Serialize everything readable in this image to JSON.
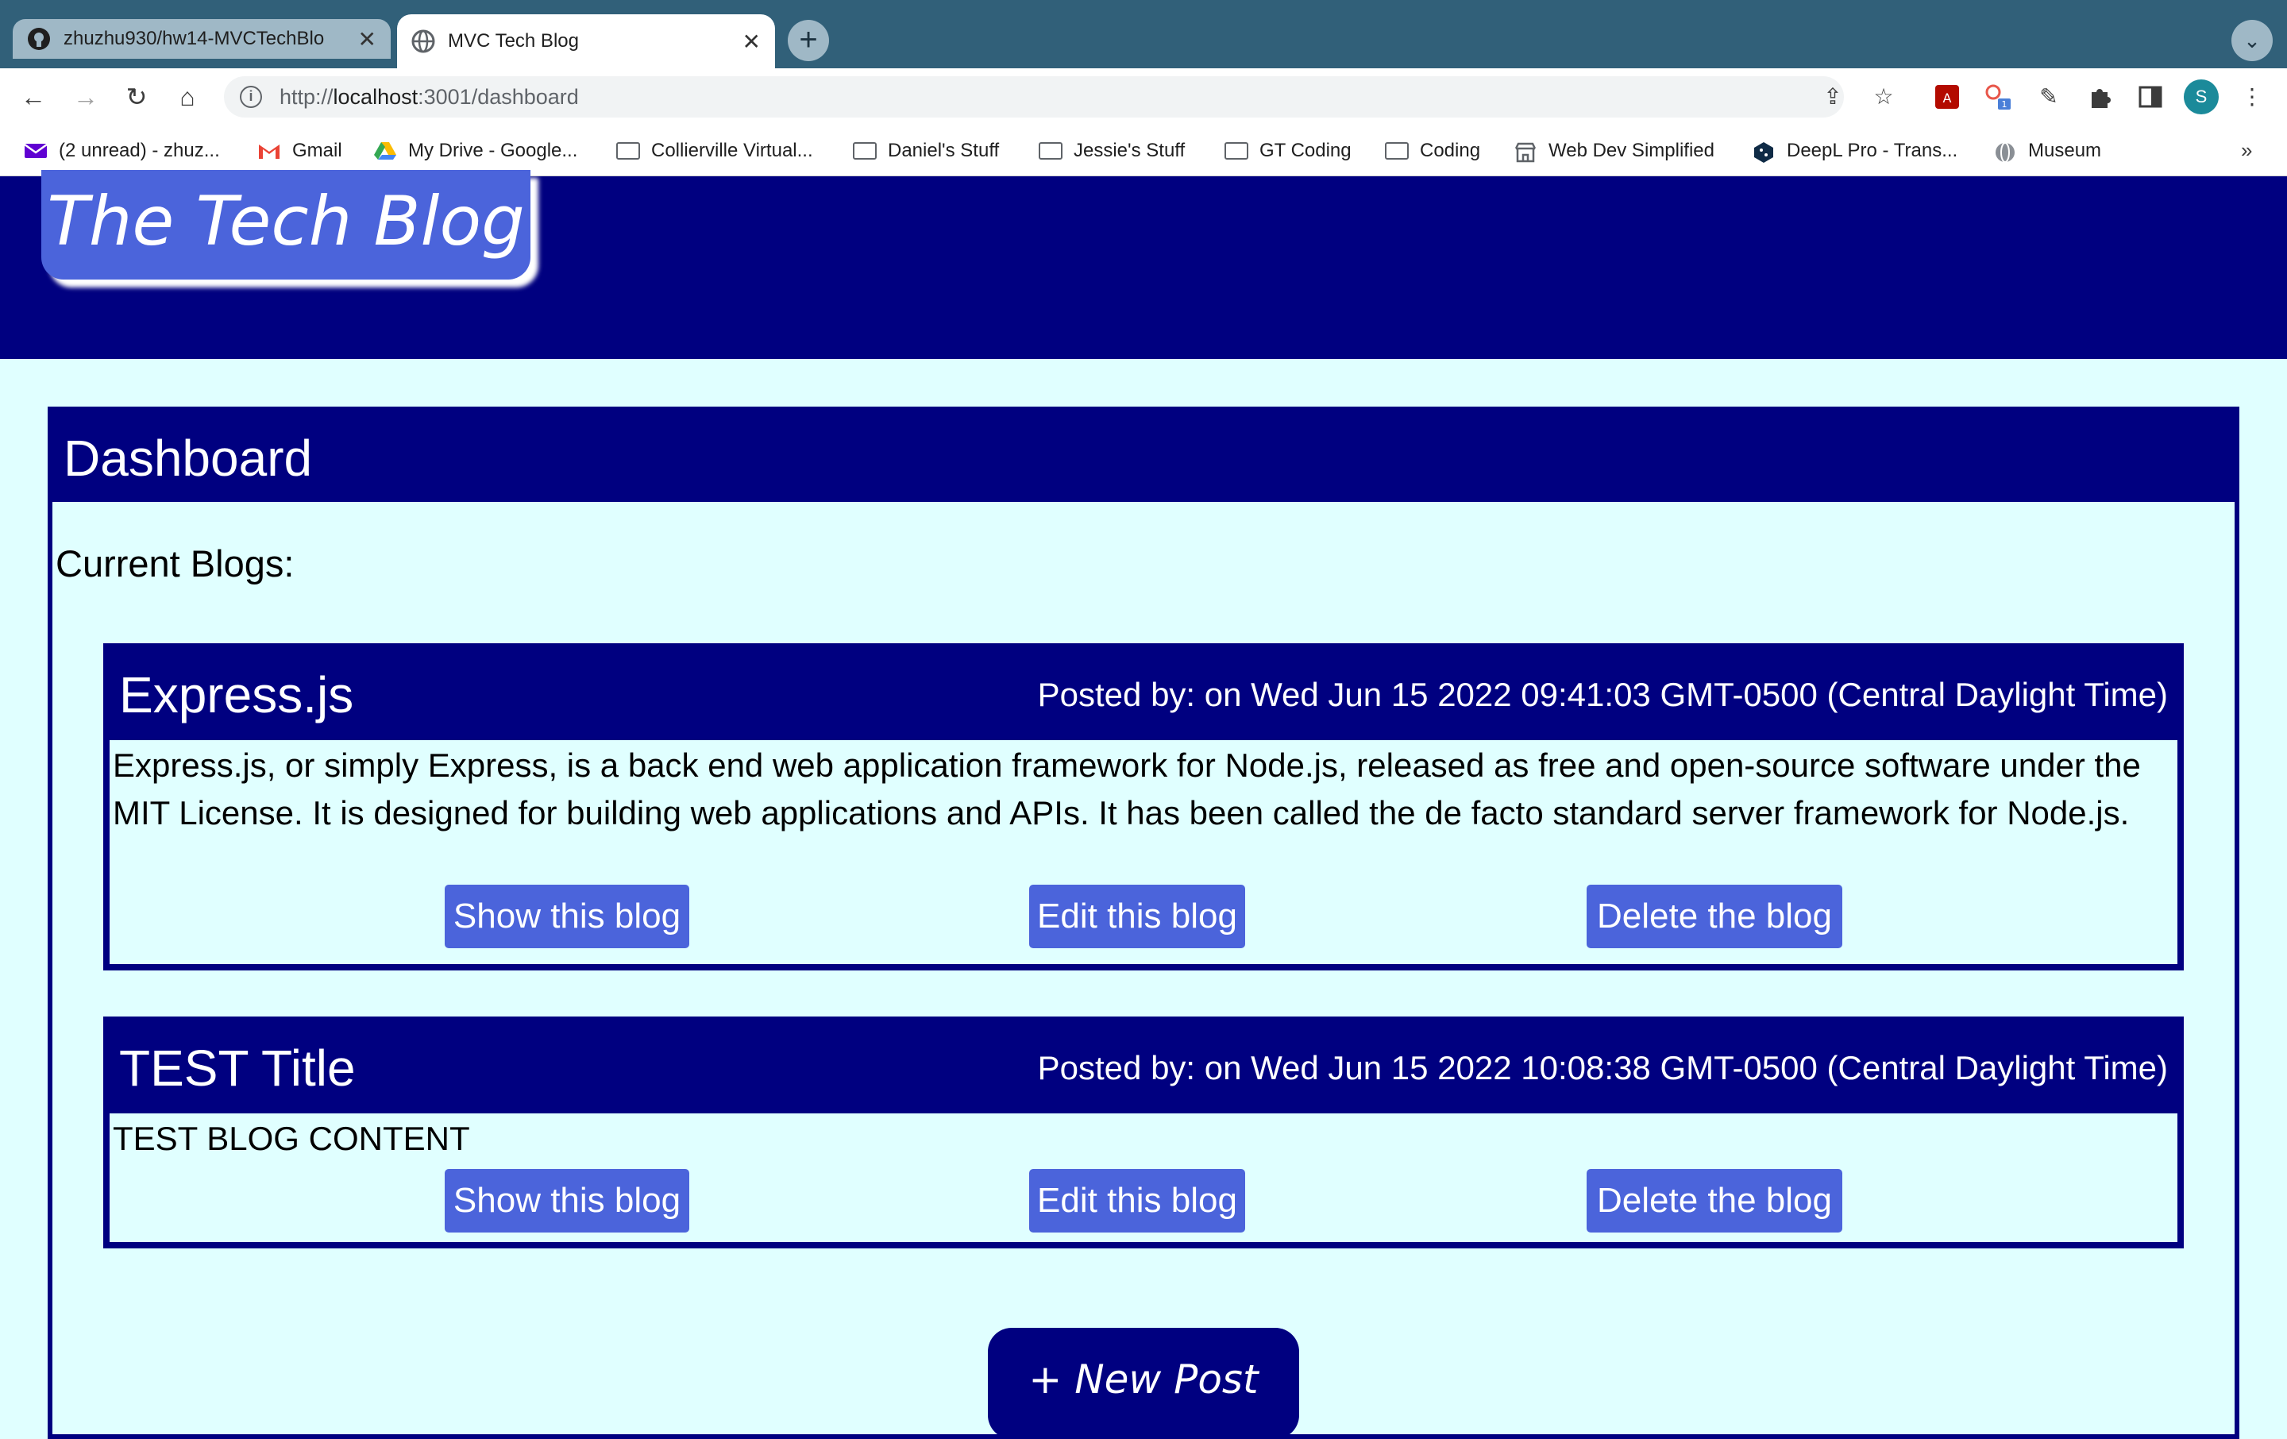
{
  "browser": {
    "tabs": [
      {
        "title": "zhuzhu930/hw14-MVCTechBlo",
        "favicon": "github-icon",
        "active": false
      },
      {
        "title": "MVC Tech Blog",
        "favicon": "globe-icon",
        "active": true
      }
    ],
    "url": {
      "scheme": "http://",
      "host": "localhost",
      "rest": ":3001/dashboard"
    },
    "avatar_letter": "S",
    "bookmarks": [
      {
        "label": "(2 unread) - zhuz...",
        "icon": "yahoo-mail-icon"
      },
      {
        "label": "Gmail",
        "icon": "gmail-icon"
      },
      {
        "label": "My Drive - Google...",
        "icon": "google-drive-icon"
      },
      {
        "label": "Collierville Virtual...",
        "icon": "folder-icon"
      },
      {
        "label": "Daniel's Stuff",
        "icon": "folder-icon"
      },
      {
        "label": "Jessie's Stuff",
        "icon": "folder-icon"
      },
      {
        "label": "GT Coding",
        "icon": "folder-icon"
      },
      {
        "label": "Coding",
        "icon": "folder-icon"
      },
      {
        "label": "Web Dev Simplified",
        "icon": "storefront-icon"
      },
      {
        "label": "DeepL Pro - Trans...",
        "icon": "deepl-icon"
      },
      {
        "label": "Museum",
        "icon": "globe-icon"
      }
    ],
    "bookmarks_more": "»"
  },
  "site": {
    "logo": "The Tech Blog"
  },
  "dashboard": {
    "heading": "Dashboard",
    "subheading": "Current Blogs:",
    "posts": [
      {
        "title": "Express.js",
        "meta": "Posted by: on Wed Jun 15 2022 09:41:03 GMT-0500 (Central Daylight Time)",
        "content": "Express.js, or simply Express, is a back end web application framework for Node.js, released as free and open-source software under the MIT License. It is designed for building web applications and APIs. It has been called the de facto standard server framework for Node.js.",
        "show_label": "Show this blog",
        "edit_label": "Edit this blog",
        "delete_label": "Delete the blog"
      },
      {
        "title": "TEST Title",
        "meta": "Posted by: on Wed Jun 15 2022 10:08:38 GMT-0500 (Central Daylight Time)",
        "content": "TEST BLOG CONTENT",
        "show_label": "Show this blog",
        "edit_label": "Edit this blog",
        "delete_label": "Delete the blog"
      }
    ],
    "new_post_label": "+ New Post"
  },
  "colors": {
    "navy": "#000080",
    "button_blue": "#4b64db",
    "page_bg": "#e0ffff",
    "tabstrip": "#316079"
  }
}
